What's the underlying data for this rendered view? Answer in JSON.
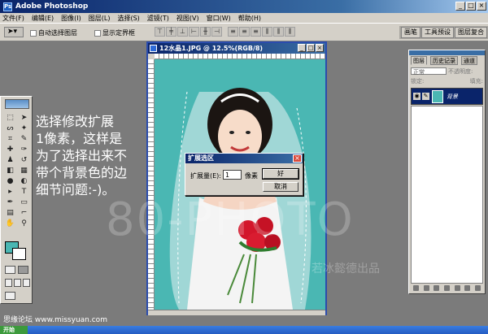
{
  "window": {
    "title": "Adobe Photoshop",
    "logo": "Ps"
  },
  "menu": {
    "items": [
      "文件(F)",
      "编辑(E)",
      "图像(I)",
      "图层(L)",
      "选择(S)",
      "滤镜(T)",
      "视图(V)",
      "窗口(W)",
      "帮助(H)"
    ]
  },
  "options": {
    "auto_select_layer": "自动选择图层",
    "show_bounding_box": "显示定界框",
    "palette_tabs": [
      "画笔",
      "工具预设",
      "图层复合"
    ]
  },
  "overlay_text": {
    "lines": [
      "选择修改扩展",
      "1像素，这样是",
      "为了选择出来不",
      "带个背景色的边",
      "细节问题:-)。"
    ]
  },
  "document": {
    "title": "12水晶1.JPG @ 12.5%(RGB/8)"
  },
  "dialog": {
    "title": "扩展选区",
    "close": "×",
    "label": "扩展量(E):",
    "value": "1",
    "unit": "像素",
    "ok": "好",
    "cancel": "取消"
  },
  "layers_panel": {
    "tabs": [
      "图层",
      "历史记录",
      "通道"
    ],
    "blend_mode": "正常",
    "opacity_label": "不透明度:",
    "lock_label": "锁定:",
    "fill_label": "填充:",
    "layer_name": "背景"
  },
  "watermark": {
    "big": "80-PHOTO",
    "small": "若冰懿德出品"
  },
  "footer": {
    "forum": "思缘论坛 www.missyuan.com",
    "start": "开始"
  },
  "colors": {
    "foreground": "#4ab7b3",
    "background": "#ffffff",
    "canvas_bg": "#4ab7b3"
  }
}
